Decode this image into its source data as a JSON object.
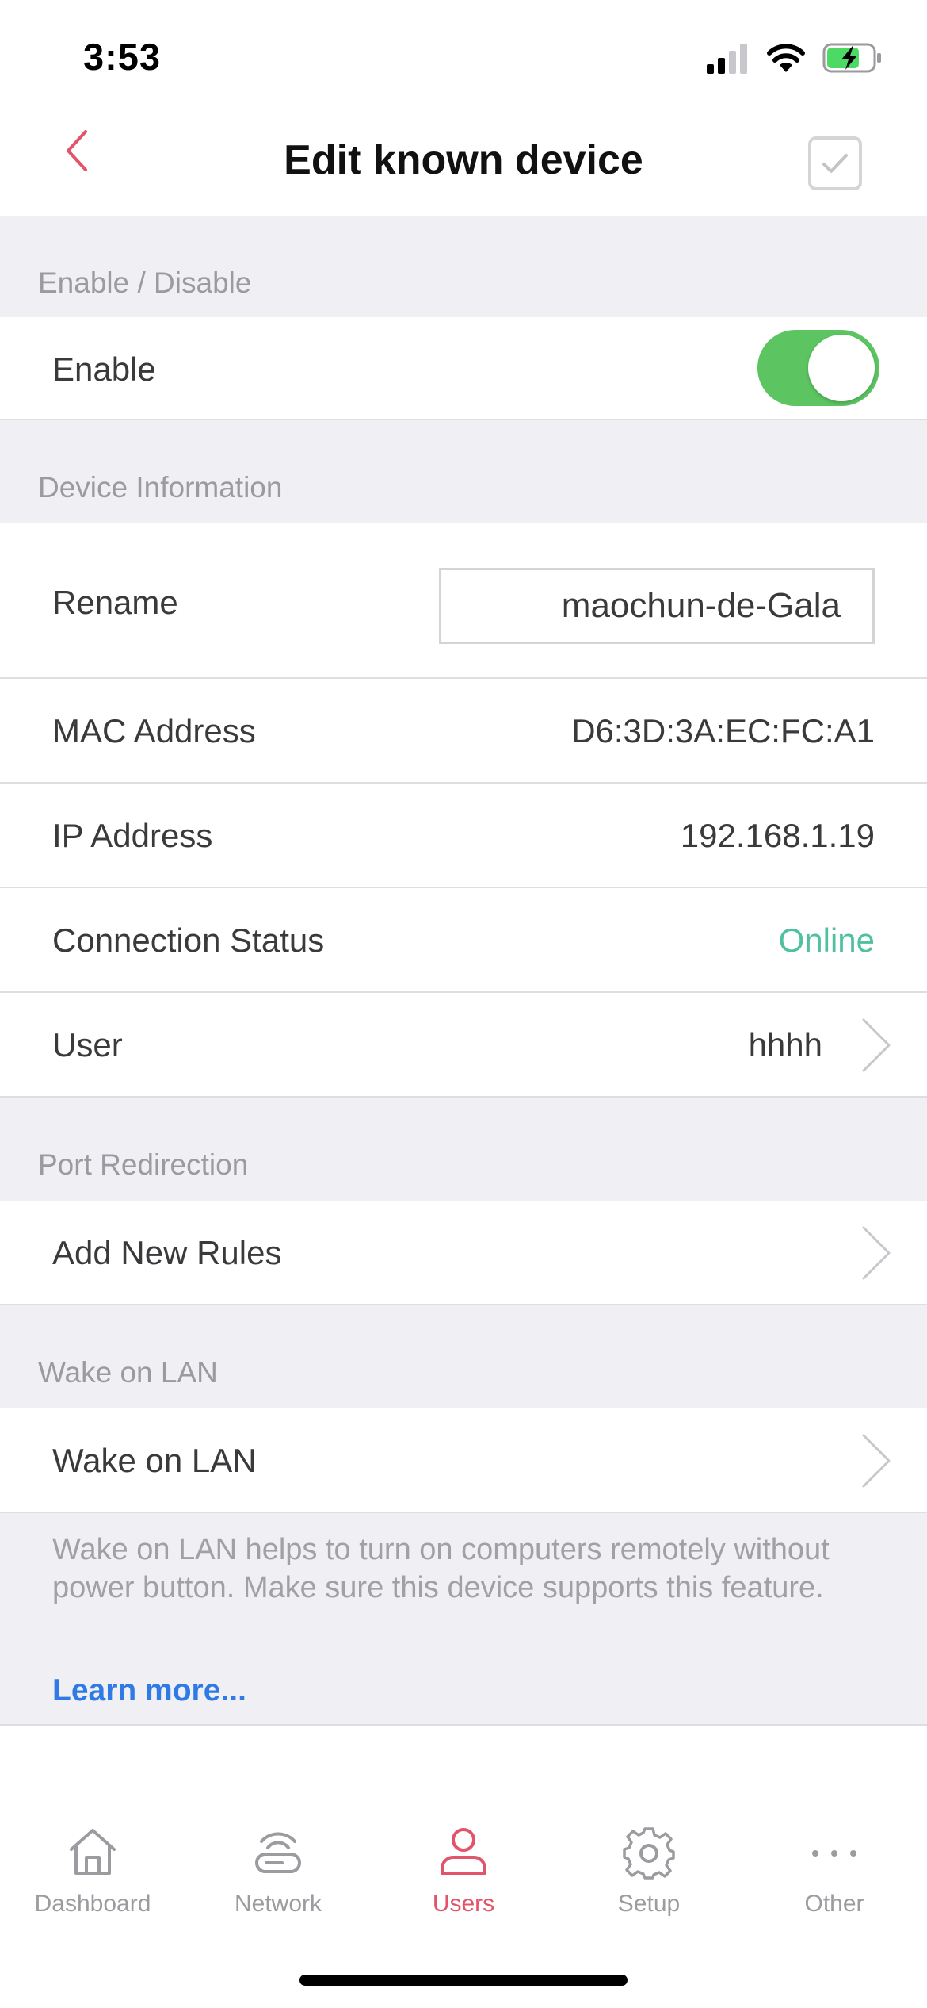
{
  "status_bar": {
    "time": "3:53"
  },
  "header": {
    "title": "Edit known device"
  },
  "sections": {
    "enable": {
      "label": "Enable / Disable",
      "row_label": "Enable",
      "toggle_on": true
    },
    "device_info": {
      "label": "Device Information",
      "rename_label": "Rename",
      "rename_value": "maochun-de-Gala",
      "mac_label": "MAC Address",
      "mac_value": "D6:3D:3A:EC:FC:A1",
      "ip_label": "IP Address",
      "ip_value": "192.168.1.19",
      "status_label": "Connection Status",
      "status_value": "Online",
      "user_label": "User",
      "user_value": "hhhh"
    },
    "port_redirection": {
      "label": "Port Redirection",
      "row_label": "Add New Rules"
    },
    "wake_on_lan": {
      "label": "Wake on LAN",
      "row_label": "Wake on LAN",
      "description": "Wake on LAN helps to turn on computers remotely without power button. Make sure this device supports this feature.",
      "learn_more": "Learn more..."
    }
  },
  "tabbar": {
    "items": [
      {
        "label": "Dashboard",
        "icon": "home-icon"
      },
      {
        "label": "Network",
        "icon": "router-icon"
      },
      {
        "label": "Users",
        "icon": "user-icon",
        "active": true
      },
      {
        "label": "Setup",
        "icon": "gear-icon"
      },
      {
        "label": "Other",
        "icon": "more-icon"
      }
    ]
  },
  "colors": {
    "accent": "#e2546a",
    "toggle_on": "#5cc461",
    "online": "#4fc0a0",
    "link": "#2f7ae5"
  }
}
